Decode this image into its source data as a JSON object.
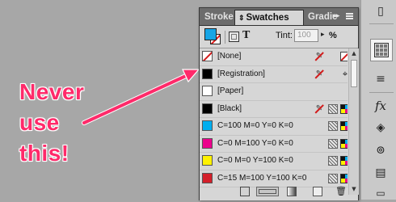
{
  "annotation": {
    "lines": [
      "Never",
      "use",
      "this!"
    ],
    "color": "#ff2a6a"
  },
  "panel": {
    "tabs": [
      {
        "label": "Stroke",
        "active": false
      },
      {
        "label": "Swatches",
        "active": true
      },
      {
        "label": "Gradie",
        "active": false
      }
    ],
    "tab_sort_icon": "updown-arrows-icon",
    "collapse_icon": "double-chevron-right-icon",
    "menu_icon": "panel-menu-icon",
    "tint_label": "Tint:",
    "tint_value": "100",
    "tint_unit": "%",
    "swatches": [
      {
        "name": "[None]",
        "chip": "#ffffff"
      },
      {
        "name": "[Registration]",
        "chip": "#000000"
      },
      {
        "name": "[Paper]",
        "chip": "#ffffff"
      },
      {
        "name": "[Black]",
        "chip": "#000000"
      },
      {
        "name": "C=100 M=0 Y=0 K=0",
        "chip": "#00aeef"
      },
      {
        "name": "C=0 M=100 Y=0 K=0",
        "chip": "#ec008c"
      },
      {
        "name": "C=0 M=0 Y=100 K=0",
        "chip": "#fff200"
      },
      {
        "name": "C=15 M=100 Y=100 K=0",
        "chip": "#d41f2a"
      }
    ]
  },
  "colors": {
    "background": "#a7a7a7",
    "panel_bg": "#d6d6d6",
    "tabbar_bg": "#6c6c6c",
    "fill_swatch": "#17a5e6"
  }
}
